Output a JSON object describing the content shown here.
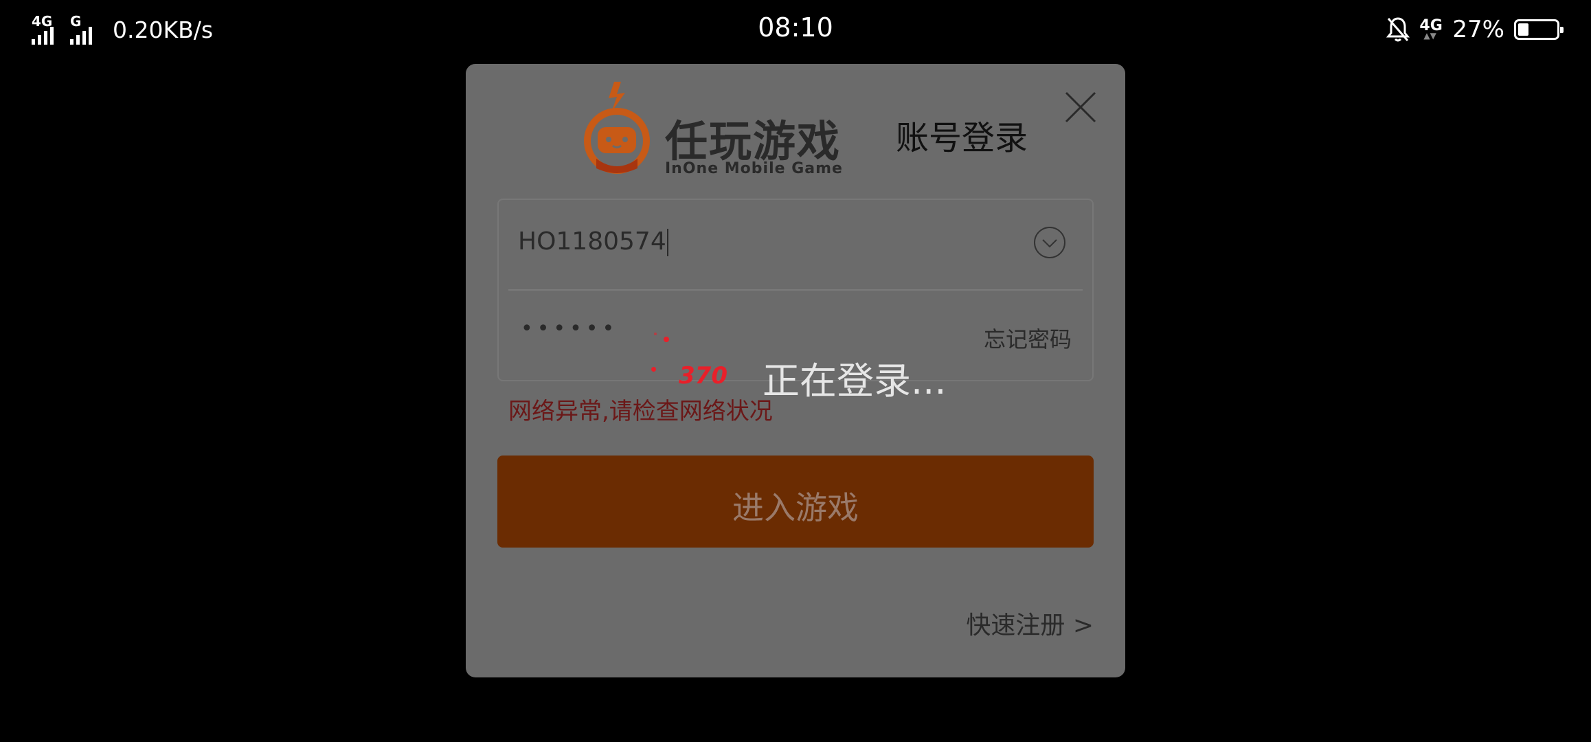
{
  "status_bar": {
    "network_1": "4G",
    "network_2": "G",
    "speed": "0.20KB/s",
    "time": "08:10",
    "network_right": "4G",
    "battery_percent": "27%",
    "battery_level": 0.27
  },
  "dialog": {
    "brand_name": "任玩游戏",
    "brand_sub": "InOne Mobile Game",
    "title": "账号登录",
    "account_value": "HO1180574",
    "password_mask": "••••••",
    "forgot_password": "忘记密码",
    "error_message": "网络异常,请检查网络状况",
    "enter_button": "进入游戏",
    "register_link": "快速注册 >"
  },
  "loading": {
    "logo_text": "370",
    "message": "正在登录..."
  },
  "colors": {
    "brand_orange": "#e2661a",
    "error_red": "#6b1818",
    "spinner_red": "#e8202a"
  }
}
